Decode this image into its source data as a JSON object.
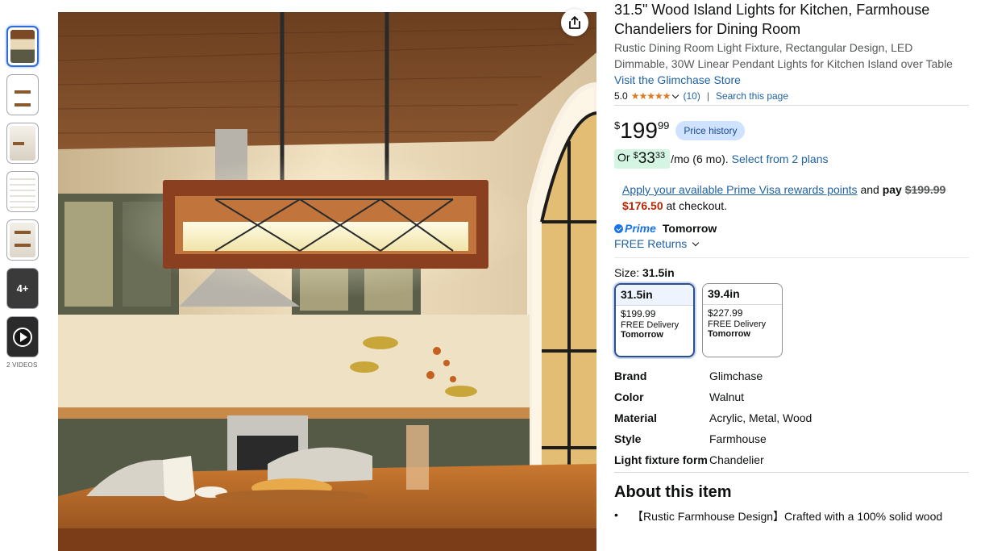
{
  "gallery": {
    "thumbnails": [
      "thumb-1",
      "thumb-2",
      "thumb-3",
      "thumb-4",
      "thumb-5"
    ],
    "more_count": "4+",
    "videos_label": "2 VIDEOS"
  },
  "product": {
    "title": "31.5\" Wood Island Lights for Kitchen, Farmhouse Chandeliers for Dining Room",
    "subtitle": "Rustic Dining Room Light Fixture, Rectangular Design, LED Dimmable, 30W Linear Pendant Lights for Kitchen Island over Table",
    "store_link": "Visit the Glimchase Store",
    "rating_value": "5.0",
    "stars": "★★★★★",
    "rating_count": "(10)",
    "search_page": "Search this page"
  },
  "price": {
    "symbol": "$",
    "whole": "199",
    "fraction": "99",
    "history_label": "Price history",
    "monthly_prefix": "Or",
    "monthly_symbol": "$",
    "monthly_whole": "33",
    "monthly_fraction": "33",
    "monthly_suffix": "/mo (6 mo).",
    "plans_link": "Select from 2 plans"
  },
  "visa": {
    "link": "Apply your available Prime Visa rewards points",
    "and_text": "and",
    "pay_text": "pay",
    "old_price": "$199.99",
    "new_price": "$176.50",
    "checkout_text": "at checkout."
  },
  "delivery": {
    "prime_label": "Prime",
    "day": "Tomorrow",
    "returns": "FREE Returns"
  },
  "size": {
    "label": "Size:",
    "selected": "31.5in",
    "options": [
      {
        "name": "31.5in",
        "price": "$199.99",
        "delivery": "FREE Delivery",
        "day": "Tomorrow"
      },
      {
        "name": "39.4in",
        "price": "$227.99",
        "delivery": "FREE Delivery",
        "day": "Tomorrow"
      }
    ]
  },
  "specs": [
    {
      "key": "Brand",
      "value": "Glimchase"
    },
    {
      "key": "Color",
      "value": "Walnut"
    },
    {
      "key": "Material",
      "value": "Acrylic, Metal, Wood"
    },
    {
      "key": "Style",
      "value": "Farmhouse"
    },
    {
      "key": "Light fixture form",
      "value": "Chandelier"
    }
  ],
  "about": {
    "title": "About this item",
    "bullets": [
      "【Rustic Farmhouse Design】Crafted with a 100% solid wood"
    ]
  },
  "colors": {
    "link": "#2162a1",
    "star": "#de7921",
    "red_price": "#b12704",
    "prime": "#1a73e8"
  }
}
